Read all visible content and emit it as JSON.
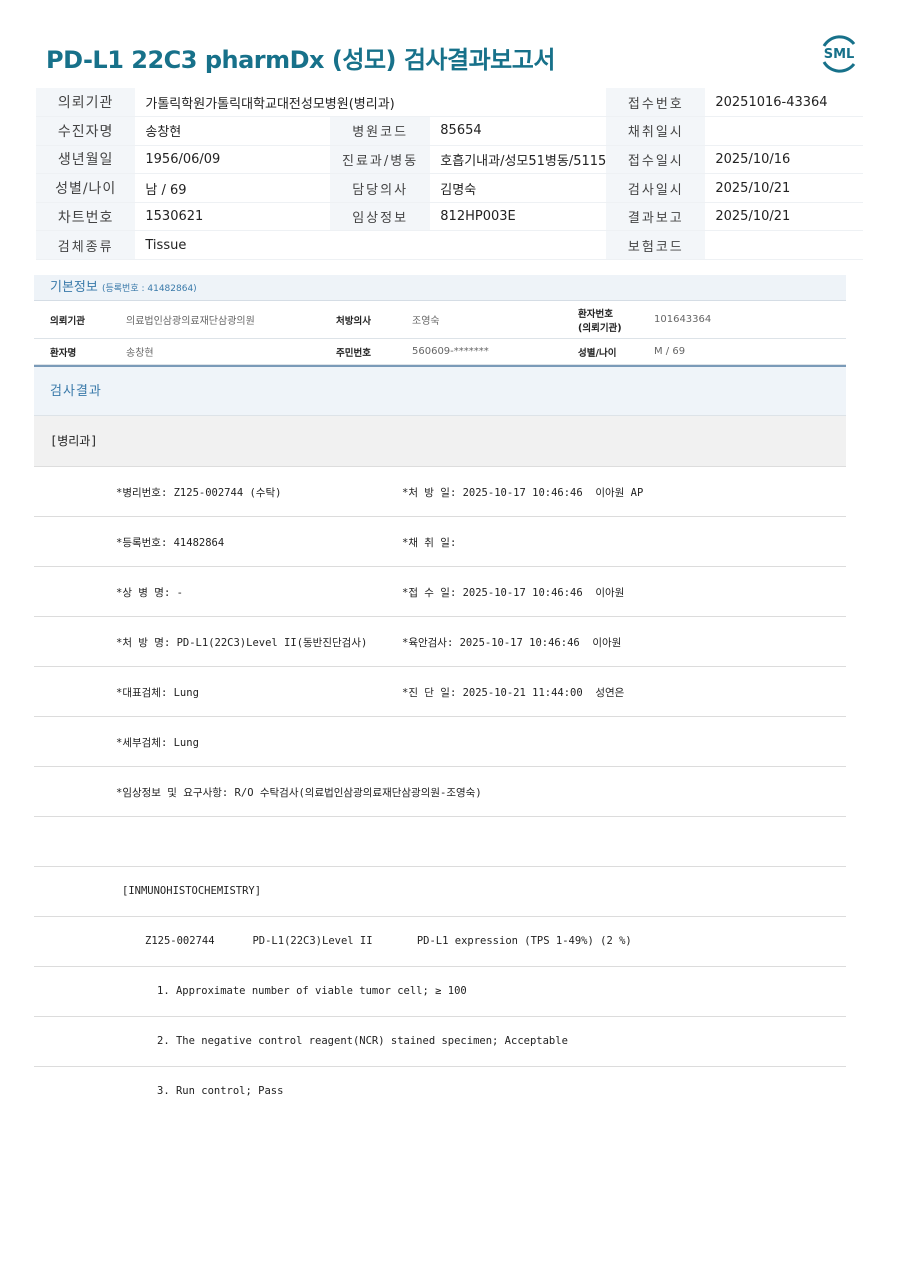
{
  "title": "PD-L1 22C3 pharmDx (성모) 검사결과보고서",
  "logo": "SML",
  "colors": {
    "brand": "#17718a",
    "accent": "#3a7aaa"
  },
  "top_table": [
    [
      {
        "l": "의뢰기관",
        "v": "가톨릭학원가톨릭대학교대전성모병원(병리과)"
      },
      null,
      {
        "l": "접수번호",
        "v": "20251016-43364"
      }
    ],
    [
      {
        "l": "수진자명",
        "v": "송창현"
      },
      {
        "l": "병원코드",
        "v": "85654"
      },
      {
        "l": "채취일시",
        "v": ""
      }
    ],
    [
      {
        "l": "생년월일",
        "v": "1956/06/09"
      },
      {
        "l": "진료과/병동",
        "v": "호흡기내과/성모51병동/5115"
      },
      {
        "l": "접수일시",
        "v": "2025/10/16"
      }
    ],
    [
      {
        "l": "성별/나이",
        "v": "남 / 69"
      },
      {
        "l": "담당의사",
        "v": "김명숙"
      },
      {
        "l": "검사일시",
        "v": "2025/10/21"
      }
    ],
    [
      {
        "l": "차트번호",
        "v": "1530621"
      },
      {
        "l": "임상정보",
        "v": "812HP003E"
      },
      {
        "l": "결과보고",
        "v": "2025/10/21"
      }
    ],
    [
      {
        "l": "검체종류",
        "v": "Tissue"
      },
      null,
      {
        "l": "보험코드",
        "v": ""
      }
    ]
  ],
  "basic": {
    "title": "기본정보",
    "reg": "(등록번호 : 41482864)",
    "rows": [
      [
        "의뢰기관",
        "의료법인삼광의료재단삼광의원",
        "처방의사",
        "조영숙",
        "환자번호\n(의뢰기관)",
        "101643364"
      ],
      [
        "환자명",
        "송창현",
        "주민번호",
        "560609-*******",
        "성별/나이",
        "M / 69"
      ]
    ]
  },
  "result_title": "검사결과",
  "dept": "[병리과]",
  "fields": [
    [
      "*병리번호: Z125-002744 (수탁)",
      "*처 방 일: 2025-10-17 10:46:46  이아원 AP"
    ],
    [
      "*등록번호: 41482864",
      "*채 취 일:"
    ],
    [
      "*상 병 명: -",
      "*접 수 일: 2025-10-17 10:46:46  이아원"
    ],
    [
      "*처 방 명: PD-L1(22C3)Level II(동반진단검사)",
      "*육안검사: 2025-10-17 10:46:46  이아원"
    ],
    [
      "*대표검체: Lung",
      "*진 단 일: 2025-10-21 11:44:00  성연은"
    ],
    [
      "*세부검체: Lung",
      ""
    ],
    [
      "*임상정보 및 요구사항: R/O 수탁검사(의료법인삼광의료재단삼광의원-조영숙)",
      ""
    ]
  ],
  "ihc": {
    "header": "[INMUNOHISTOCHEMISTRY]",
    "line": "Z125-002744      PD-L1(22C3)Level II       PD-L1 expression (TPS 1-49%) (2 %)",
    "items": [
      "1. Approximate number of viable tumor cell; ≥ 100",
      "2. The negative control reagent(NCR) stained specimen; Acceptable",
      "3. Run control; Pass"
    ]
  }
}
